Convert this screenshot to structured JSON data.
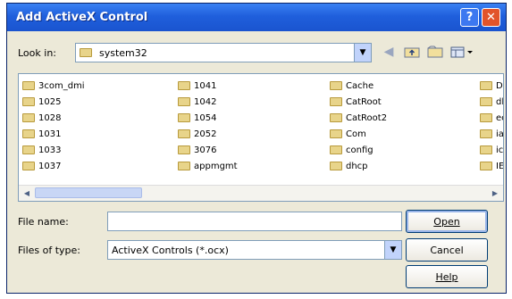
{
  "window": {
    "title": "Add ActiveX Control",
    "help_label": "?",
    "close_label": "✕"
  },
  "look_in": {
    "label": "Look in:",
    "value": "system32"
  },
  "toolbar": {
    "icons": [
      "back-icon",
      "up-folder-icon",
      "new-folder-icon",
      "view-menu-icon"
    ]
  },
  "file_list": {
    "columns": [
      [
        "3com_dmi",
        "1025",
        "1028",
        "1031",
        "1033",
        "1037"
      ],
      [
        "1041",
        "1042",
        "1054",
        "2052",
        "3076",
        "appmgmt"
      ],
      [
        "Cache",
        "CatRoot",
        "CatRoot2",
        "Com",
        "config",
        "dhcp"
      ],
      [
        "Dr",
        "dl",
        "ec",
        "ia",
        "ic",
        "IE"
      ]
    ]
  },
  "file_name": {
    "label": "File name:",
    "value": ""
  },
  "file_type": {
    "label": "Files of type:",
    "value": "ActiveX Controls (*.ocx)"
  },
  "buttons": {
    "open": "Open",
    "cancel": "Cancel",
    "help": "Help"
  },
  "colors": {
    "title_bar": "#1f5fdc",
    "dialog_bg": "#ece9d8",
    "close_button": "#e2542b"
  }
}
